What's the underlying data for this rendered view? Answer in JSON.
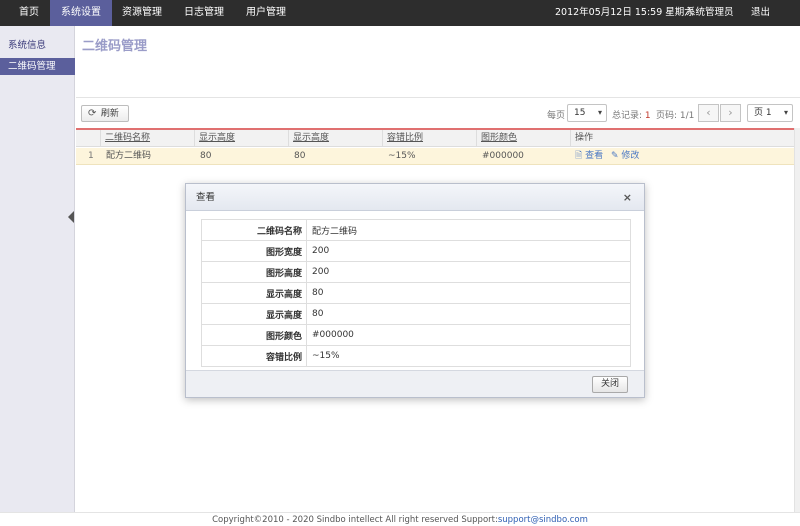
{
  "nav": {
    "items": [
      {
        "label": "首页"
      },
      {
        "label": "系统设置"
      },
      {
        "label": "资源管理"
      },
      {
        "label": "日志管理"
      },
      {
        "label": "用户管理"
      }
    ],
    "active_index": 1,
    "datetime": "2012年05月12日 15:59 星期六",
    "user": "系统管理员",
    "logout": "退出"
  },
  "sidebar": {
    "items": [
      {
        "label": "系统信息"
      },
      {
        "label": "二维码管理"
      }
    ],
    "active_index": 1
  },
  "page": {
    "title": "二维码管理"
  },
  "toolbar": {
    "refresh_label": "刷新",
    "refresh_icon": "refresh-icon"
  },
  "pager": {
    "per_page_label": "每页",
    "per_page_value": "15",
    "total_label": "总记录:",
    "total_value": "1",
    "page_label": "页码:",
    "page_value": "1/1",
    "prev": "‹",
    "next": "›",
    "page_select": "页 1"
  },
  "table": {
    "headers": [
      "二维码名称",
      "显示高度",
      "显示高度",
      "容错比例",
      "图形颜色",
      "操作"
    ],
    "rows": [
      {
        "index": "1",
        "name": "配方二维码",
        "col1": "80",
        "col2": "80",
        "ratio": "~15%",
        "color": "#000000"
      }
    ],
    "actions": {
      "view": "查看",
      "edit": "修改"
    }
  },
  "modal": {
    "title": "查看",
    "close": "×",
    "fields": [
      {
        "key": "二维码名称",
        "value": "配方二维码"
      },
      {
        "key": "图形宽度",
        "value": "200"
      },
      {
        "key": "图形高度",
        "value": "200"
      },
      {
        "key": "显示高度",
        "value": "80"
      },
      {
        "key": "显示高度",
        "value": "80"
      },
      {
        "key": "图形颜色",
        "value": "#000000"
      },
      {
        "key": "容错比例",
        "value": "~15%"
      }
    ],
    "close_button": "关闭"
  },
  "footer": {
    "text": "Copyright©2010 - 2020 Sindbo intellect All right reserved Support:",
    "email": "support@sindbo.com"
  },
  "colors": {
    "topbar": "#2d2d2d",
    "accent": "#5b5f9c",
    "row_highlight": "#fdf5dc",
    "title": "#9a9cc8",
    "link": "#4a78c4"
  }
}
